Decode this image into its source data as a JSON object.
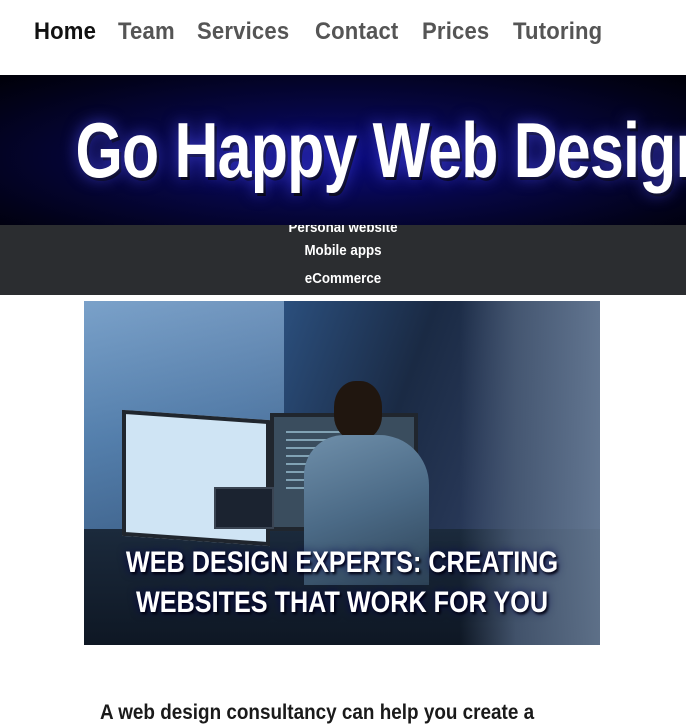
{
  "nav": {
    "items": [
      {
        "label": "Home",
        "active": true
      },
      {
        "label": "Team",
        "active": false
      },
      {
        "label": "Services",
        "active": false
      },
      {
        "label": "Contact",
        "active": false
      },
      {
        "label": "Prices",
        "active": false
      },
      {
        "label": "Tutoring",
        "active": false
      }
    ]
  },
  "banner": {
    "title": "Go Happy Web Design"
  },
  "submenu": {
    "items": [
      "Personal website",
      "Mobile apps",
      "eCommerce"
    ]
  },
  "hero": {
    "caption_line1": "WEB DESIGN EXPERTS: CREATING",
    "caption_line2": "WEBSITES THAT WORK FOR YOU"
  },
  "content": {
    "intro": "A web design consultancy can help you create a"
  },
  "colors": {
    "nav_active": "#111111",
    "nav_inactive": "#555555",
    "banner_bg": "#060640",
    "submenu_bg": "#2b2d30"
  }
}
